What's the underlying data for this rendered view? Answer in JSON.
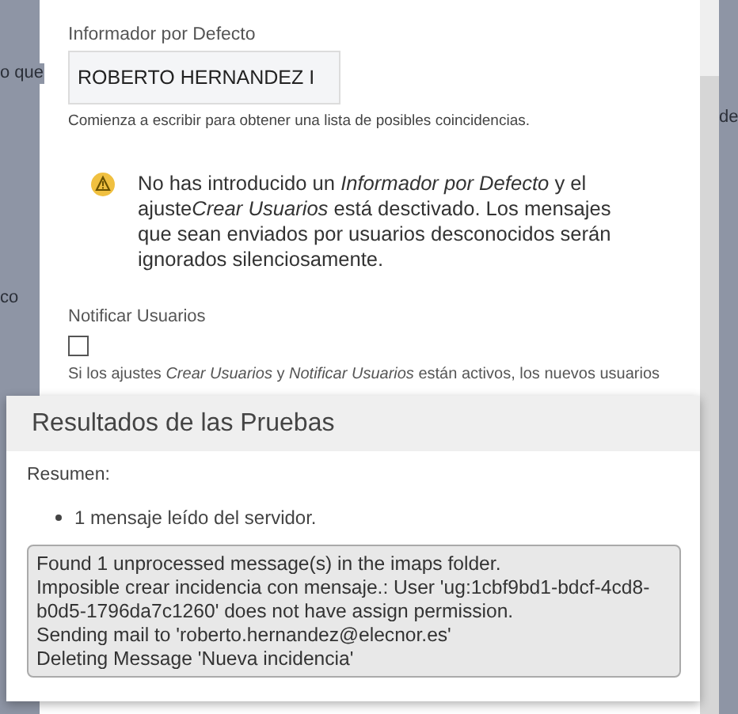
{
  "background_texts": [
    "o que",
    "de",
    "co"
  ],
  "form": {
    "default_reporter": {
      "label": "Informador por Defecto",
      "value": "ROBERTO HERNANDEZ I",
      "help": "Comienza a escribir para obtener una lista de posibles coincidencias."
    },
    "warning": [
      {
        "text": "No has introducido un ",
        "italic": false
      },
      {
        "text": "Informador por Defecto",
        "italic": true
      },
      {
        "text": " y el ajuste",
        "italic": false
      },
      {
        "text": "Crear Usuarios",
        "italic": true
      },
      {
        "text": " está desctivado. Los mensajes que sean enviados por usuarios desconocidos serán ignorados silenciosamente.",
        "italic": false
      }
    ],
    "notify_users": {
      "label": "Notificar Usuarios",
      "checked": false
    },
    "notify_help": "Si los ajustes *Crear Usuarios* y *Notificar Usuarios* están activos, los nuevos usuarios"
  },
  "results": {
    "title": "Resultados de las Pruebas",
    "summary_label": "Resumen:",
    "summary_items": [
      "1 mensaje leído del servidor."
    ],
    "log": [
      "Found 1 unprocessed message(s) in the imaps folder.",
      "Imposible crear incidencia con mensaje.: User 'ug:1cbf9bd1-bdcf-4cd8-b0d5-1796da7c1260' does not have assign permission.",
      "Sending mail to 'roberto.hernandez@elecnor.es'",
      "Deleting Message 'Nueva incidencia'"
    ]
  }
}
